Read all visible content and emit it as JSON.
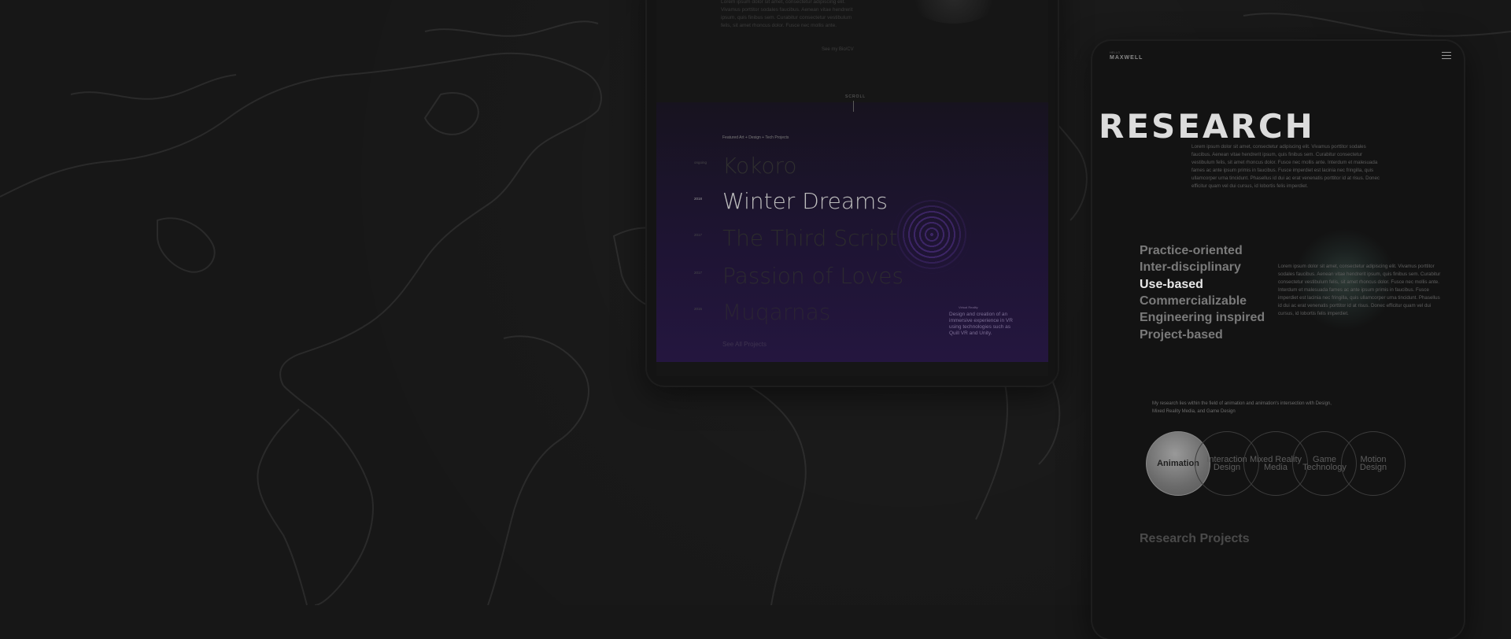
{
  "tablet": {
    "lorem": "Lorem ipsum dolor sit amet, consectetur adipiscing elit. Vivamus porttitor sodales faucibus. Aenean vitae hendrerit ipsum, quis finibus sem. Curabitur consectetur vestibulum felis, sit amet rhoncus dolor. Fusce nec mollis ante.",
    "see_bio": "See my Bio/CV",
    "scroll_label": "SCROLL",
    "featured_label": "Featured Art + Design + Tech Projects",
    "projects": [
      {
        "year": "ongoing",
        "name": "Kokoro"
      },
      {
        "year": "2018",
        "name": "Winter Dreams"
      },
      {
        "year": "2017",
        "name": "The Third Script"
      },
      {
        "year": "2017",
        "name": "Passion of Loves"
      },
      {
        "year": "2015",
        "name": "Muqarnas"
      }
    ],
    "project_desc_label": "Virtual Reality",
    "project_desc": "Design and creation of an immersive experience in VR using technologies such as Quill VR and Unity.",
    "all_projects": "See All Projects"
  },
  "phone": {
    "brand_small": "HELLO",
    "brand": "MAXWELL",
    "title": "RESEARCH",
    "intro": "Lorem ipsum dolor sit amet, consectetur adipiscing elit. Vivamus porttitor sodales faucibus. Aenean vitae hendrerit ipsum, quis finibus sem. Curabitur consectetur vestibulum felis, sit amet rhoncus dolor. Fusce nec mollis ante. Interdum et malesuada fames ac ante ipsum primis in faucibus. Fusce imperdiet est lacinia nec fringilla, quis ullamcorper urna tincidunt. Phasellus id dui ac erat venenatis porttitor id at risus. Donec efficitur quam vel dui cursus, id lobortis felis imperdiet.",
    "attributes": [
      "Practice-oriented",
      "Inter-disciplinary",
      "Use-based",
      "Commercializable",
      "Engineering inspired",
      "Project-based"
    ],
    "highlighted_attribute": "Use-based",
    "side_text": "Lorem ipsum dolor sit amet, consectetur adipiscing elit. Vivamus porttitor sodales faucibus. Aenean vitae hendrerit ipsum, quis finibus sem. Curabitur consectetur vestibulum felis, sit amet rhoncus dolor. Fusce nec mollis ante. Interdum et malesuada fames ac ante ipsum primis in faucibus. Fusce imperdiet est lacinia nec fringilla, quis ullamcorper urna tincidunt. Phasellus id dui ac erat venenatis porttitor id at risus. Donec efficitur quam vel dui cursus, id lobortis felis imperdiet.",
    "research_note": "My research lies within the field of animation and animation's intersection with Design, Mixed Reality Media, and Game Design",
    "topics": [
      "Animation",
      "Interaction Design",
      "Mixed Reality Media",
      "Game Technology",
      "Motion Design"
    ],
    "active_topic": "Animation",
    "research_projects": "Research Projects"
  }
}
